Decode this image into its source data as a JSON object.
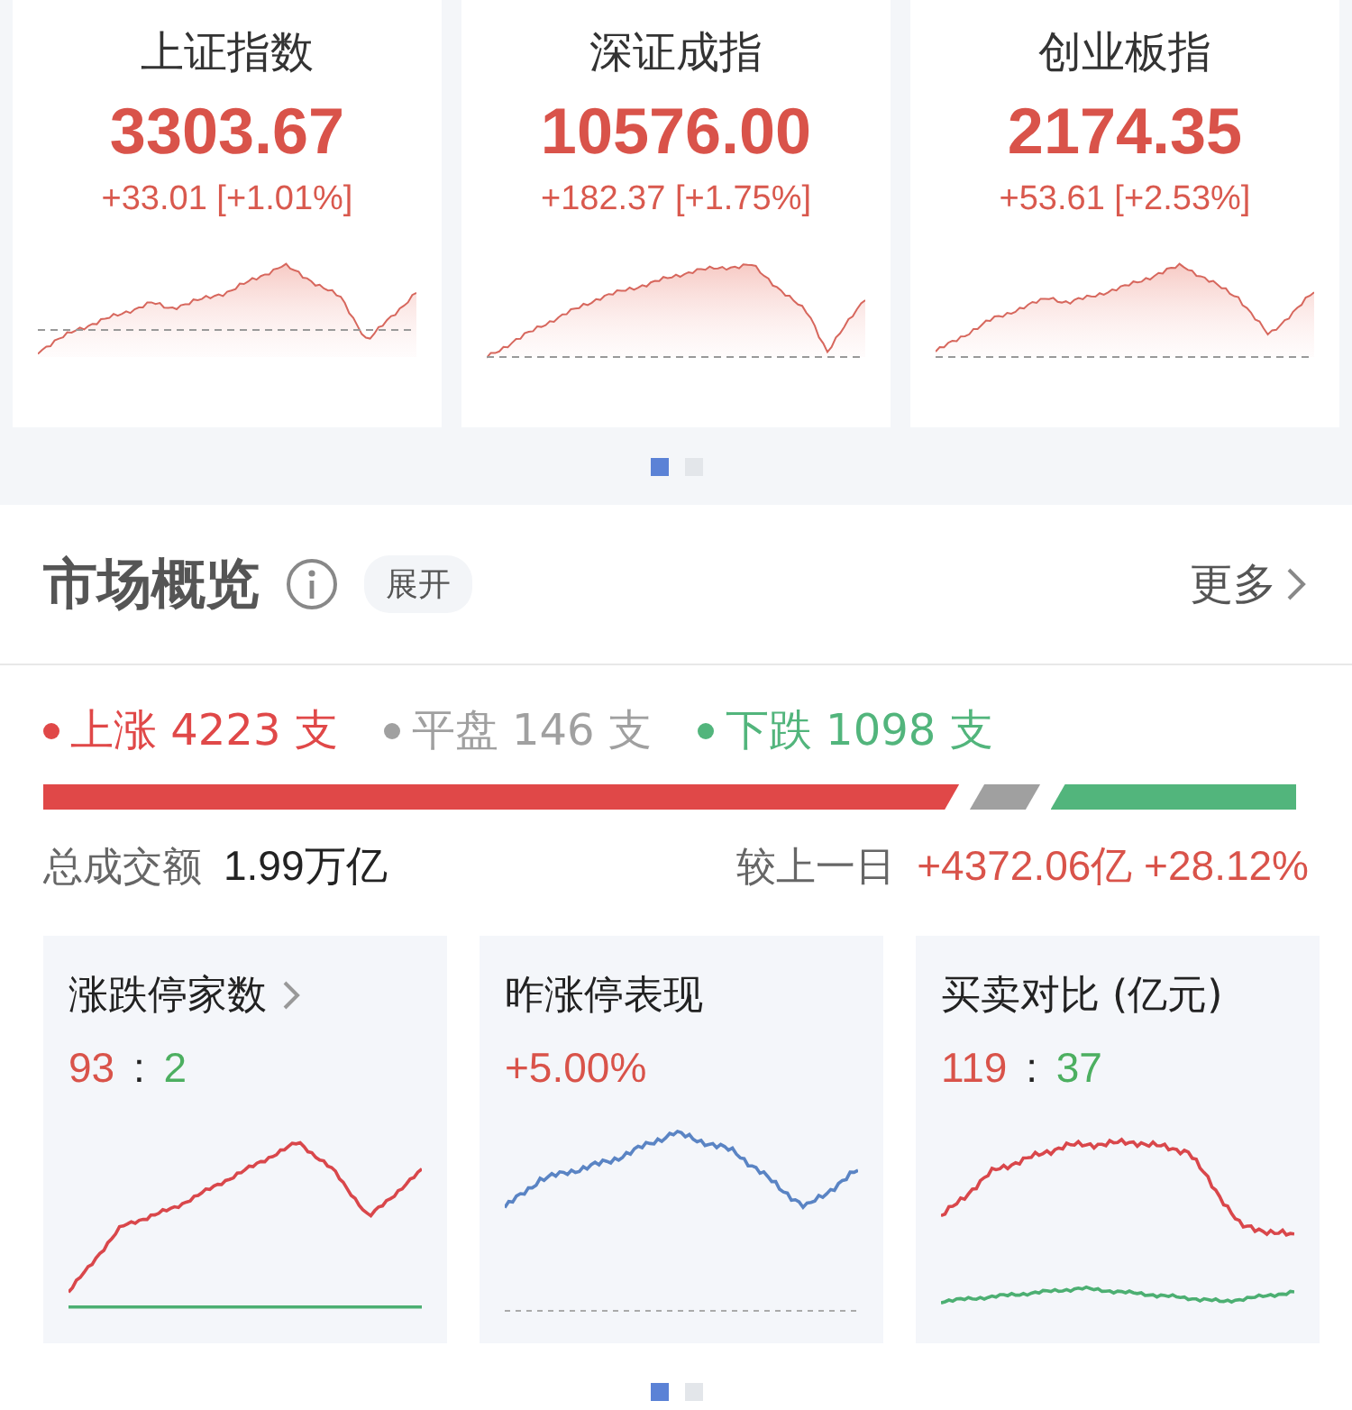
{
  "indices": [
    {
      "name": "上证指数",
      "value": "3303.67",
      "change": "+33.01 [+1.01%]"
    },
    {
      "name": "深证成指",
      "value": "10576.00",
      "change": "+182.37 [+1.75%]"
    },
    {
      "name": "创业板指",
      "value": "2174.35",
      "change": "+53.61 [+2.53%]"
    }
  ],
  "index_pager": [
    {
      "selected": true
    },
    {
      "selected": false
    }
  ],
  "market_overview": {
    "title": "市场概览",
    "expand_button": "展开",
    "more_link": "更多",
    "breadth": [
      {
        "label": "上涨 4223 支",
        "color": "#e04848"
      },
      {
        "label": "平盘 146 支",
        "color": "#a0a0a0"
      },
      {
        "label": "下跌 1098 支",
        "color": "#52b57c"
      }
    ],
    "turnover_label": "总成交额",
    "turnover_value": "1.99万亿",
    "compare_label": "较上一日",
    "compare_value": "+4372.06亿 +28.12%"
  },
  "stat_cards": [
    {
      "kind": "ratio",
      "title": "涨跌停家数",
      "has_arrow": true,
      "up": "93",
      "separator": ":",
      "down": "2"
    },
    {
      "kind": "value",
      "title": "昨涨停表现",
      "has_arrow": false,
      "value": "+5.00%"
    },
    {
      "kind": "ratio",
      "title": "买卖对比 (亿元)",
      "has_arrow": false,
      "up": "119",
      "separator": ":",
      "down": "37"
    }
  ],
  "cards_pager": [
    {
      "selected": true
    },
    {
      "selected": false
    }
  ]
}
